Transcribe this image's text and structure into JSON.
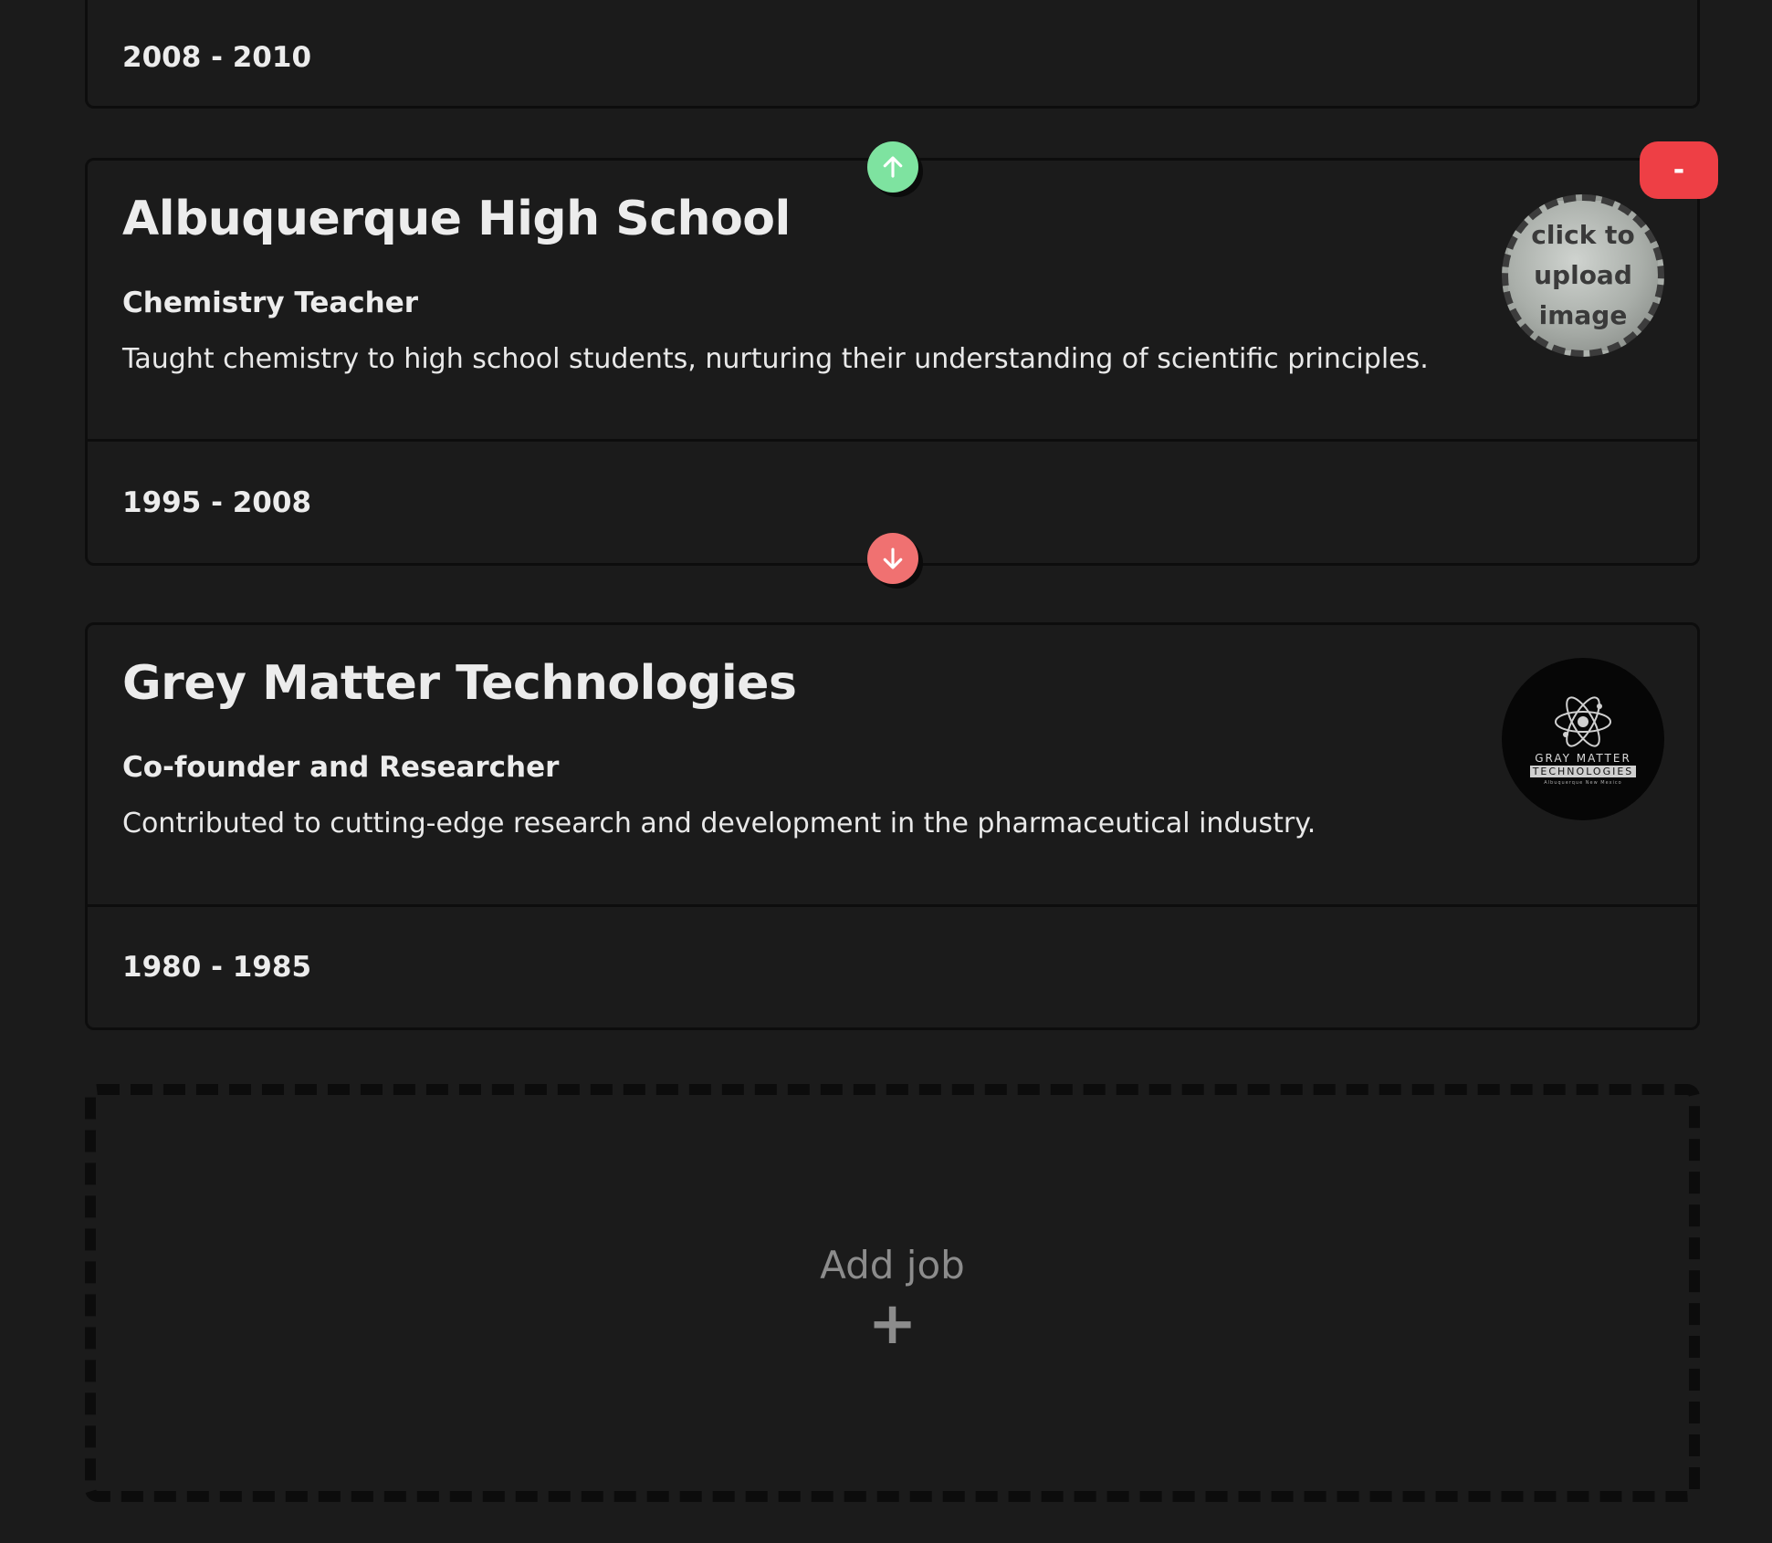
{
  "jobs": [
    {
      "dates": "2008 - 2010"
    },
    {
      "company": "Albuquerque High School",
      "role": "Chemistry Teacher",
      "description": "Taught chemistry to high school students, nurturing their understanding of scientific principles.",
      "dates": "1995 - 2008",
      "image_prompt": "click to upload image"
    },
    {
      "company": "Grey Matter Technologies",
      "role": "Co-founder and Researcher",
      "description": "Contributed to cutting-edge research and development in the pharmaceutical industry.",
      "dates": "1980 - 1985",
      "logo": {
        "line1": "GRAY MATTER",
        "line2": "TECHNOLOGIES",
        "line3": "Albuquerque New Mexico"
      }
    }
  ],
  "controls": {
    "remove_label": "-",
    "move_up_icon": "arrow-up-icon",
    "move_down_icon": "arrow-down-icon"
  },
  "add_job": {
    "label": "Add job",
    "plus": "+"
  },
  "colors": {
    "background": "#1b1b1b",
    "move_up": "#7ee3a0",
    "move_down": "#f07171",
    "remove": "#ee3f45"
  }
}
